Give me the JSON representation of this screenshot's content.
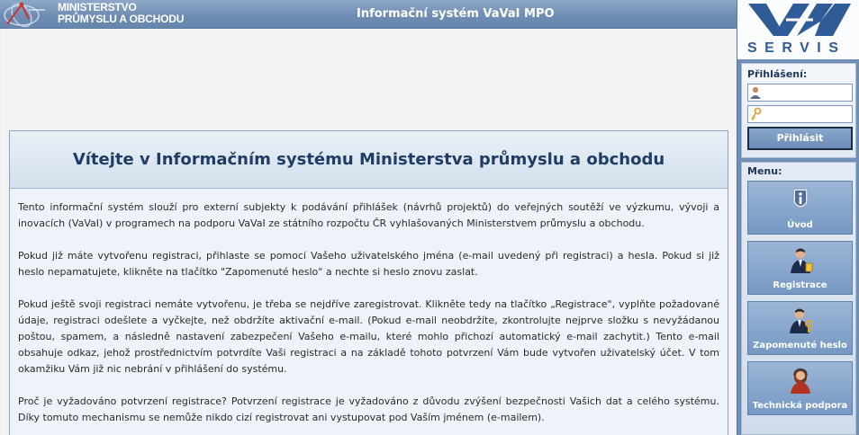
{
  "header": {
    "logo_line1": "MINISTERSTVO",
    "logo_line2": "PRŮMYSLU A OBCHODU",
    "app_title": "Informační systém VaVaI MPO"
  },
  "brand": {
    "text": "SERVIS"
  },
  "login": {
    "label": "Přihlášení:",
    "username_value": "",
    "password_value": "",
    "submit_label": "Přihlásit"
  },
  "menu": {
    "label": "Menu:",
    "items": [
      {
        "label": "Úvod",
        "icon": "info-icon"
      },
      {
        "label": "Registrace",
        "icon": "user-add-icon"
      },
      {
        "label": "Zapomenuté heslo",
        "icon": "user-key-icon"
      },
      {
        "label": "Technická podpora",
        "icon": "support-icon"
      }
    ]
  },
  "content": {
    "title": "Vítejte v Informačním systému Ministerstva průmyslu a obchodu",
    "paragraphs": [
      "Tento informační systém slouží pro externí subjekty k podávání přihlášek (návrhů projektů) do veřejných soutěží ve výzkumu, vývoji a inovacích (VaVaI) v programech na podporu VaVaI ze státního rozpočtu ČR vyhlašovaných Ministerstvem průmyslu a obchodu.",
      "Pokud již máte vytvořenu registraci, přihlaste se pomocí Vašeho uživatelského jména (e-mail uvedený při registraci) a hesla. Pokud si již heslo nepamatujete, klikněte na tlačítko \"Zapomenuté heslo\" a nechte si heslo znovu zaslat.",
      "Pokud ještě svoji registraci nemáte vytvořenu, je třeba se nejdříve zaregistrovat. Klikněte tedy na tlačítko „Registrace\", vyplňte požadované údaje, registraci odešlete a vyčkejte, než obdržíte aktivační e-mail. (Pokud e-mail neobdržíte, zkontrolujte nejprve složku s nevyžádanou poštou, spamem, a následně nastavení zabezpečení Vašeho e-mailu, které mohlo přichozí automatický e-mail zachytit.) Tento e-mail obsahuje odkaz, jehož prostřednictvím potvrdíte Vaši registraci a na základě tohoto potvrzení Vám bude vytvořen uživatelský účet. V tom okamžiku Vám již nic nebrání v přihlášení do systému.",
      "Proč je vyžadováno potvrzení registrace? Potvrzení registrace je vyžadováno z důvodu zvýšení bezpečnosti Vašich dat a celého systému. Díky tomuto mechanismu se nemůže nikdo cizí registrovat ani vystupovat pod Vaším jménem (e-mailem)."
    ]
  },
  "colors": {
    "header_bg": "#7290b6",
    "sidebar_bg": "#6f8fb6",
    "title_text": "#1f3d64",
    "brand_blue": "#2f5c96"
  }
}
